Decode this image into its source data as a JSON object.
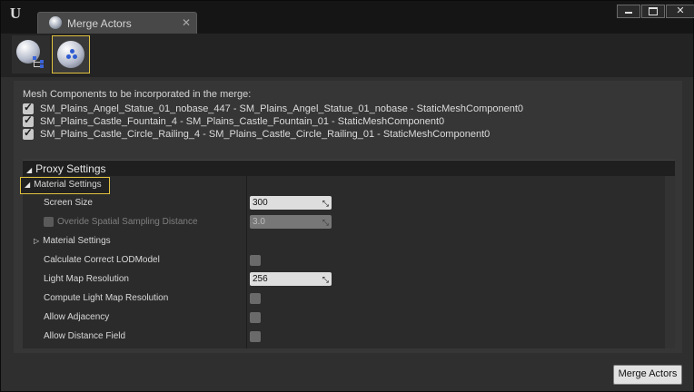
{
  "titlebar": {
    "tab_title": "Merge Actors",
    "tab_close_glyph": "✕",
    "window_buttons": {
      "minimize": "",
      "maximize": "",
      "close": "✕"
    }
  },
  "toolbar": {
    "buttons": [
      {
        "name": "hierarchy-merge-icon",
        "selected": false
      },
      {
        "name": "proxy-merge-icon",
        "selected": true
      }
    ]
  },
  "mesh_components": {
    "header": "Mesh Components to be incorporated in the merge:",
    "items": [
      {
        "label": "SM_Plains_Angel_Statue_01_nobase_447 - SM_Plains_Angel_Statue_01_nobase - StaticMeshComponent0",
        "checked": true
      },
      {
        "label": "SM_Plains_Castle_Fountain_4 - SM_Plains_Castle_Fountain_01 - StaticMeshComponent0",
        "checked": true
      },
      {
        "label": "SM_Plains_Castle_Circle_Railing_4 - SM_Plains_Castle_Circle_Railing_01 - StaticMeshComponent0",
        "checked": true
      }
    ]
  },
  "proxy_settings": {
    "title": "Proxy Settings",
    "group_label": "Material Settings",
    "screen_size": {
      "label": "Screen Size",
      "value": "300"
    },
    "override_spatial": {
      "label": "Overide Spatial Sampling Distance",
      "value": "3.0",
      "enabled": false
    },
    "material_settings_sub": {
      "label": "Material Settings"
    },
    "calc_lod": {
      "label": "Calculate Correct LODModel",
      "checked": false
    },
    "light_map_res": {
      "label": "Light Map Resolution",
      "value": "256"
    },
    "compute_light_map": {
      "label": "Compute Light Map Resolution",
      "checked": false
    },
    "allow_adjacency": {
      "label": "Allow Adjacency",
      "checked": false
    },
    "allow_distance_field": {
      "label": "Allow Distance Field",
      "checked": false
    }
  },
  "footer": {
    "merge_button": "Merge Actors"
  },
  "colors": {
    "highlight": "#e2c23e",
    "panel": "#363636",
    "background": "#2f2f2f"
  }
}
